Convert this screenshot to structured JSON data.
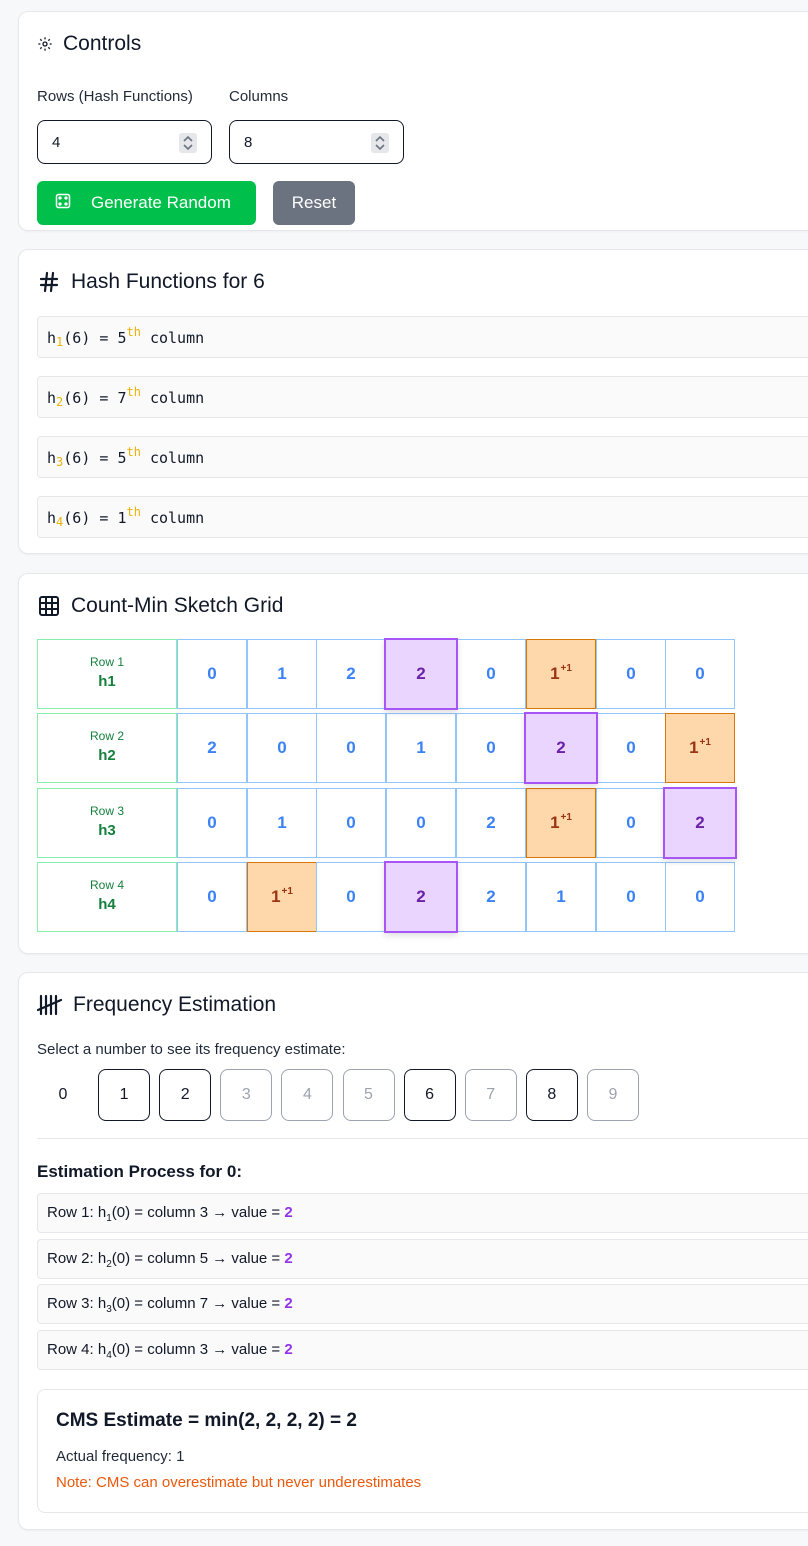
{
  "controls": {
    "title": "Controls",
    "rows_label": "Rows (Hash Functions)",
    "rows_value": "4",
    "cols_label": "Columns",
    "cols_value": "8",
    "generate_label": "Generate Random",
    "reset_label": "Reset"
  },
  "hash": {
    "title": "Hash Functions for 6",
    "items": [
      {
        "h": "h",
        "i": "1",
        "arg": "(6) = 5",
        "sup": "th",
        "tail": " column"
      },
      {
        "h": "h",
        "i": "2",
        "arg": "(6) = 7",
        "sup": "th",
        "tail": " column"
      },
      {
        "h": "h",
        "i": "3",
        "arg": "(6) = 5",
        "sup": "th",
        "tail": " column"
      },
      {
        "h": "h",
        "i": "4",
        "arg": "(6) = 1",
        "sup": "th",
        "tail": " column"
      }
    ]
  },
  "grid": {
    "title": "Count-Min Sketch Grid",
    "rows": [
      {
        "label": "Row 1",
        "fn": "h1",
        "cells": [
          "0",
          "1",
          "2",
          "2",
          "0",
          "1",
          "0",
          "0"
        ],
        "highlight": 3,
        "increment": 5
      },
      {
        "label": "Row 2",
        "fn": "h2",
        "cells": [
          "2",
          "0",
          "0",
          "1",
          "0",
          "2",
          "0",
          "1"
        ],
        "highlight": 5,
        "increment": 7
      },
      {
        "label": "Row 3",
        "fn": "h3",
        "cells": [
          "0",
          "1",
          "0",
          "0",
          "2",
          "1",
          "0",
          "2"
        ],
        "highlight": 7,
        "increment": 5
      },
      {
        "label": "Row 4",
        "fn": "h4",
        "cells": [
          "0",
          "1",
          "0",
          "2",
          "2",
          "1",
          "0",
          "0"
        ],
        "highlight": 3,
        "increment": 1
      }
    ],
    "increment_mark": "+1"
  },
  "freq": {
    "title": "Frequency Estimation",
    "subtitle": "Select a number to see its frequency estimate:",
    "numbers": [
      {
        "n": "0",
        "state": "selected"
      },
      {
        "n": "1",
        "state": "active"
      },
      {
        "n": "2",
        "state": "active"
      },
      {
        "n": "3",
        "state": "dim"
      },
      {
        "n": "4",
        "state": "dim"
      },
      {
        "n": "5",
        "state": "dim"
      },
      {
        "n": "6",
        "state": "active"
      },
      {
        "n": "7",
        "state": "dim"
      },
      {
        "n": "8",
        "state": "active"
      },
      {
        "n": "9",
        "state": "dim"
      }
    ],
    "process_heading": "Estimation Process for 0:",
    "steps": [
      {
        "pre": "Row 1: h",
        "sub": "1",
        "post": "(0) = column 3 → value = ",
        "value": "2"
      },
      {
        "pre": "Row 2: h",
        "sub": "2",
        "post": "(0) = column 5 → value = ",
        "value": "2"
      },
      {
        "pre": "Row 3: h",
        "sub": "3",
        "post": "(0) = column 7 → value = ",
        "value": "2"
      },
      {
        "pre": "Row 4: h",
        "sub": "4",
        "post": "(0) = column 3 → value = ",
        "value": "2"
      }
    ],
    "estimate": "CMS Estimate = min(2, 2, 2, 2) = 2",
    "actual": "Actual frequency: 1",
    "note": "Note: CMS can overestimate but never underestimates"
  },
  "colors": {
    "generate": "#00c04b",
    "reset": "#6b7280",
    "highlight": "#a855f7",
    "increment": "#fed7aa",
    "note": "#ea580c"
  }
}
